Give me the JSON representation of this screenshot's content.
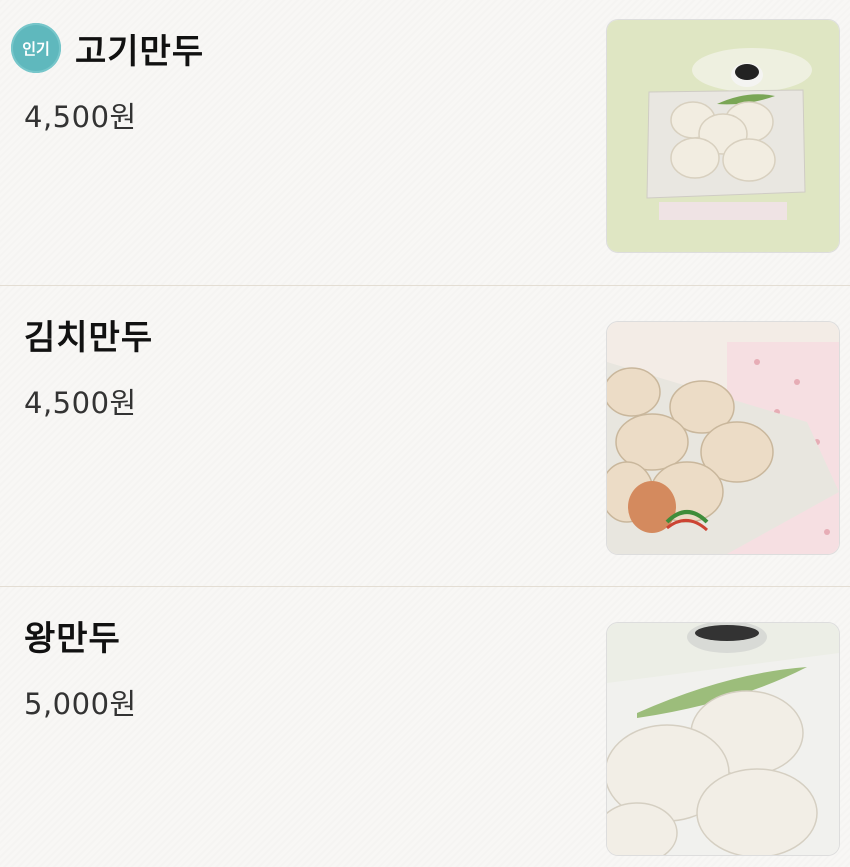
{
  "menu": {
    "items": [
      {
        "name": "고기만두",
        "price": "4,500원",
        "badge": "인기",
        "image_icon": "meat-dumpling-photo"
      },
      {
        "name": "김치만두",
        "price": "4,500원",
        "image_icon": "kimchi-dumpling-photo"
      },
      {
        "name": "왕만두",
        "price": "5,000원",
        "image_icon": "king-dumpling-photo"
      }
    ]
  },
  "colors": {
    "background": "#f7f6f4",
    "divider": "#e3ddd3",
    "badge": "#5fb8bd"
  }
}
